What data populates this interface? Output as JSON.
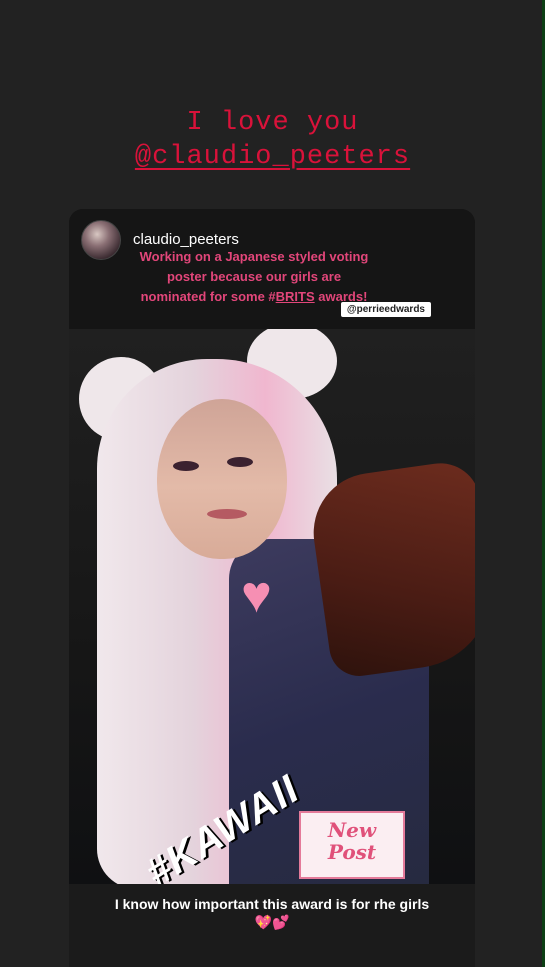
{
  "story": {
    "caption_line1": "I love you",
    "caption_line2": "@claudio_peeters"
  },
  "post": {
    "username": "claudio_peeters",
    "text_line1": "Working on a Japanese styled voting",
    "text_line2": "poster because our girls are",
    "text_line3_pre": "nominated for some #",
    "text_line3_tag": "BRITS",
    "text_line3_post": " awards!",
    "mention_sticker": "@perrieedwards"
  },
  "stickers": {
    "heart": "♥",
    "kawaii": "#KAWAII",
    "new_post_line1": "New",
    "new_post_line2": "Post"
  },
  "bottom_caption": {
    "text": "I know how important this award is for rhe girls",
    "emoji": "💖💕"
  },
  "colors": {
    "background": "#222222",
    "caption_red": "#d9123a",
    "post_pink": "#e2467a"
  }
}
